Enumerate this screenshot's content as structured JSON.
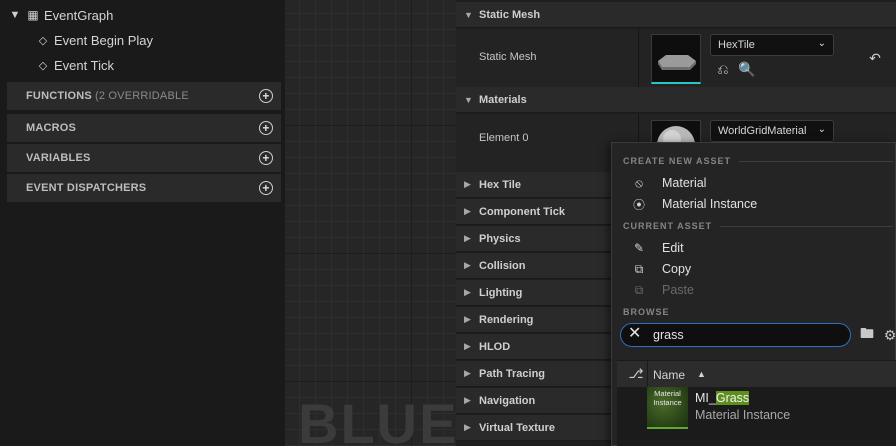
{
  "my_blueprint": {
    "graph_label": "EventGraph",
    "events": [
      "Event Begin Play",
      "Event Tick"
    ],
    "sections": [
      {
        "label": "FUNCTIONS",
        "suffix": "(2 OVERRIDABLE"
      },
      {
        "label": "MACROS",
        "suffix": ""
      },
      {
        "label": "VARIABLES",
        "suffix": ""
      },
      {
        "label": "EVENT DISPATCHERS",
        "suffix": ""
      }
    ],
    "add_symbol": "+"
  },
  "graph": {
    "watermark": "BLUEI"
  },
  "details": {
    "static_mesh_category": "Static Mesh",
    "static_mesh_label": "Static Mesh",
    "static_mesh_value": "HexTile",
    "materials_category": "Materials",
    "element_label": "Element 0",
    "material_value": "WorldGridMaterial",
    "categories": [
      "Hex Tile",
      "Component Tick",
      "Physics",
      "Collision",
      "Lighting",
      "Rendering",
      "HLOD",
      "Path Tracing",
      "Navigation",
      "Virtual Texture"
    ]
  },
  "popup": {
    "create_header": "CREATE NEW ASSET",
    "create_items": [
      "Material",
      "Material Instance"
    ],
    "current_header": "CURRENT ASSET",
    "current_items": [
      {
        "label": "Edit",
        "enabled": true
      },
      {
        "label": "Copy",
        "enabled": true
      },
      {
        "label": "Paste",
        "enabled": false
      }
    ],
    "browse_header": "BROWSE",
    "search_value": "grass",
    "column_name": "Name",
    "asset": {
      "thumb_caption": "Material Instance",
      "name_prefix": "MI_",
      "name_match": "Grass",
      "type": "Material Instance"
    }
  },
  "colors": {
    "accent_blue": "#2e6fc1",
    "highlight_green": "#5d8f1f",
    "thumb_underline": "#5ea930"
  }
}
